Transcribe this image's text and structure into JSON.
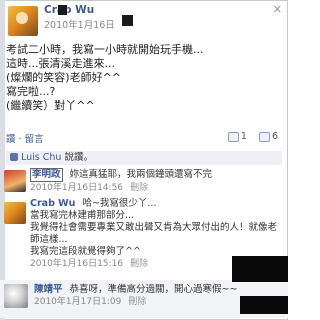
{
  "post": {
    "author": "Crab Wu",
    "date": "2010年1月16日",
    "lines": [
      "考試二小時，我寫一小時就開始玩手機...",
      "這時...張清溪走進來...",
      "(燦爛的笑容)老師好^^",
      "寫完啦...?",
      "(繼續笑）對丫^^"
    ]
  },
  "actions": {
    "like": "讚",
    "comment": "留言",
    "like_count": "1",
    "comment_count": "6"
  },
  "likes": {
    "who": "Luis Chu",
    "suffix": "說讚。"
  },
  "comments": [
    {
      "name": "李明政",
      "text": "妳這真猛耶，我兩個鐘頭還寫不完",
      "date": "2010年1月16日14:56",
      "delete": "刪除"
    },
    {
      "name": "Crab Wu",
      "lines": [
        "哈~我寫很少丫...",
        "當我寫完林建甫那部分...",
        "我覺得社會需要專業又敢出聲又肯為大眾付出的人！就像老師這樣...",
        "我寫完這段就覺得夠了^^"
      ],
      "date": "2010年1月16日15:16",
      "delete": "刪除"
    },
    {
      "name": "陳靖平",
      "text": "恭喜呀，準備高分過關，開心過寒假~~",
      "date": "2010年1月17日1:09",
      "delete": "刪除"
    }
  ],
  "icons": {
    "close": "close-icon",
    "comment": "comment-icon",
    "like": "like-icon"
  },
  "colors": {
    "link": "#3b5998",
    "meta": "#888888",
    "highlight_bg": "#edeff4"
  }
}
